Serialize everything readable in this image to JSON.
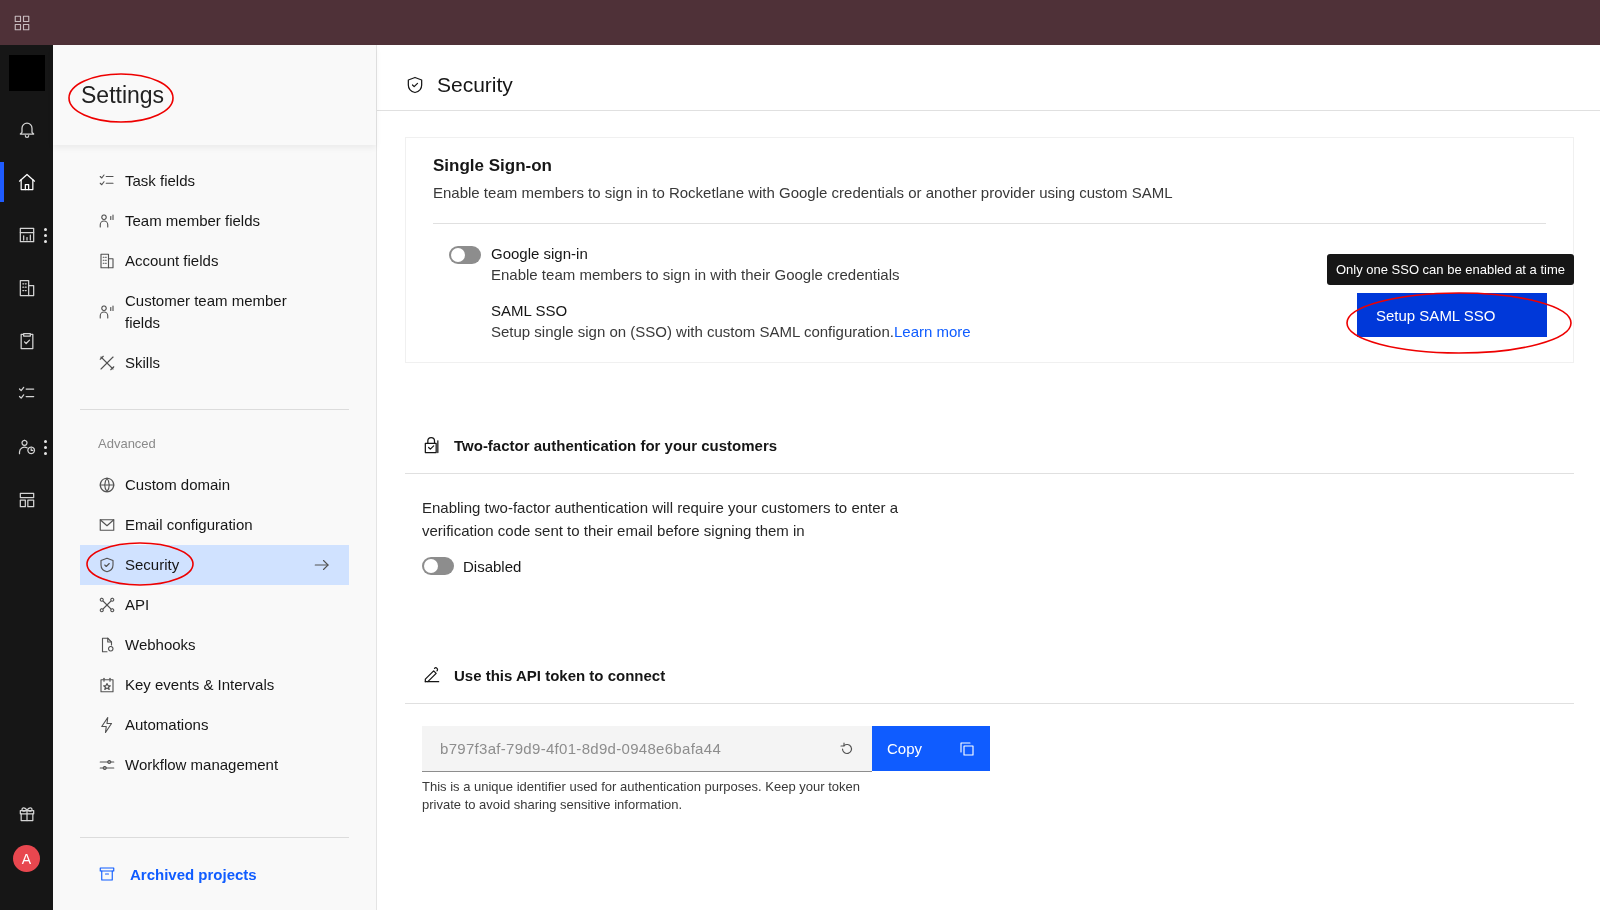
{
  "rail": {
    "items": [
      {
        "selected": false
      },
      {
        "selected": true
      },
      {
        "selected": false
      },
      {
        "selected": false
      },
      {
        "selected": false
      },
      {
        "selected": false
      },
      {
        "selected": false
      },
      {
        "selected": false
      },
      {
        "selected": false
      }
    ],
    "avatar": "A"
  },
  "sidebar": {
    "title": "Settings",
    "groups": [
      {
        "items": [
          {
            "label": "Task fields",
            "selected": false
          },
          {
            "label": "Team member fields",
            "selected": false
          },
          {
            "label": "Account fields",
            "selected": false
          },
          {
            "label": "Customer team member fields",
            "selected": false
          },
          {
            "label": "Skills",
            "selected": false
          }
        ]
      },
      {
        "heading": "Advanced",
        "items": [
          {
            "label": "Custom domain",
            "selected": false
          },
          {
            "label": "Email configuration",
            "selected": false
          },
          {
            "label": "Security",
            "selected": true
          },
          {
            "label": "API",
            "selected": false
          },
          {
            "label": "Webhooks",
            "selected": false
          },
          {
            "label": "Key events & Intervals",
            "selected": false
          },
          {
            "label": "Automations",
            "selected": false
          },
          {
            "label": "Workflow management",
            "selected": false
          }
        ]
      }
    ],
    "footer_link": "Archived projects"
  },
  "page": {
    "title": "Security"
  },
  "sso": {
    "title": "Single Sign-on",
    "description": "Enable team members to sign in to Rocketlane with Google credentials or another provider using custom SAML",
    "options": [
      {
        "kind": "toggle",
        "label": "Google sign-in",
        "description": "Enable team members to sign in with their Google credentials",
        "on": false
      },
      {
        "kind": "link",
        "label": "SAML SSO",
        "description": "Setup single sign on (SSO) with custom SAML configuration.",
        "link": "Learn more"
      }
    ],
    "tooltip": "Only one SSO can be enabled at a time",
    "button": "Setup SAML SSO"
  },
  "two_factor": {
    "title": "Two-factor authentication for your customers",
    "description": "Enabling two-factor authentication will require your customers to enter a verification code sent to their email before signing them in",
    "toggle": {
      "label": "Disabled",
      "on": false
    }
  },
  "api_token": {
    "title": "Use this API token to connect",
    "token": "b797f3af-79d9-4f01-8d9d-0948e6bafa44",
    "copy": "Copy",
    "help": "This is a unique identifier used for authentication purposes. Keep your token private to avoid sharing sensitive information."
  }
}
